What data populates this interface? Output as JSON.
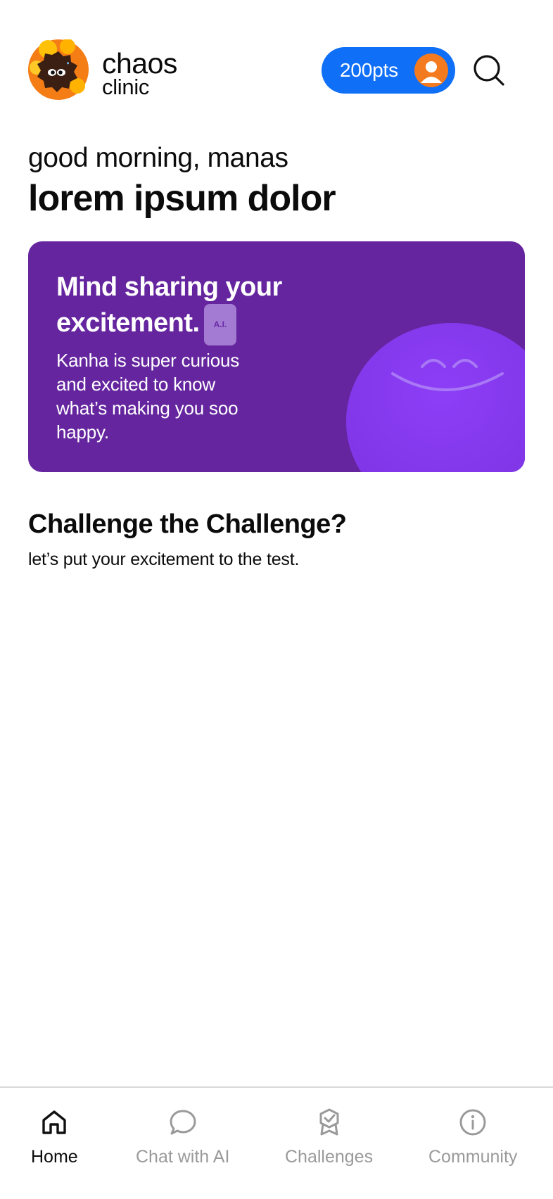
{
  "header": {
    "brand_line1": "chaos",
    "brand_line2": "clinic",
    "points": "200pts"
  },
  "greeting": {
    "salutation": "good morning, manas",
    "headline": "lorem ipsum dolor"
  },
  "mood_card": {
    "title_line1": "Mind sharing your",
    "title_line2": "excitement.",
    "badge": "A.I.",
    "body": "Kanha is super curious and excited to know what’s making you soo happy.",
    "background": "#65259f",
    "blob_color": "#8a3cf2"
  },
  "challenge_section": {
    "title": "Challenge the Challenge?",
    "subtitle": "let’s put your excitement to the test."
  },
  "bottom_nav": {
    "items": [
      {
        "label": "Home",
        "icon": "home-icon",
        "active": true
      },
      {
        "label": "Chat with AI",
        "icon": "chat-bubble-icon",
        "active": false
      },
      {
        "label": "Challenges",
        "icon": "badge-check-icon",
        "active": false
      },
      {
        "label": "Community",
        "icon": "info-icon",
        "active": false
      }
    ]
  },
  "colors": {
    "accent_blue": "#0f6ff7",
    "avatar_orange": "#f47a1f",
    "inactive_gray": "#9a9a9a"
  }
}
